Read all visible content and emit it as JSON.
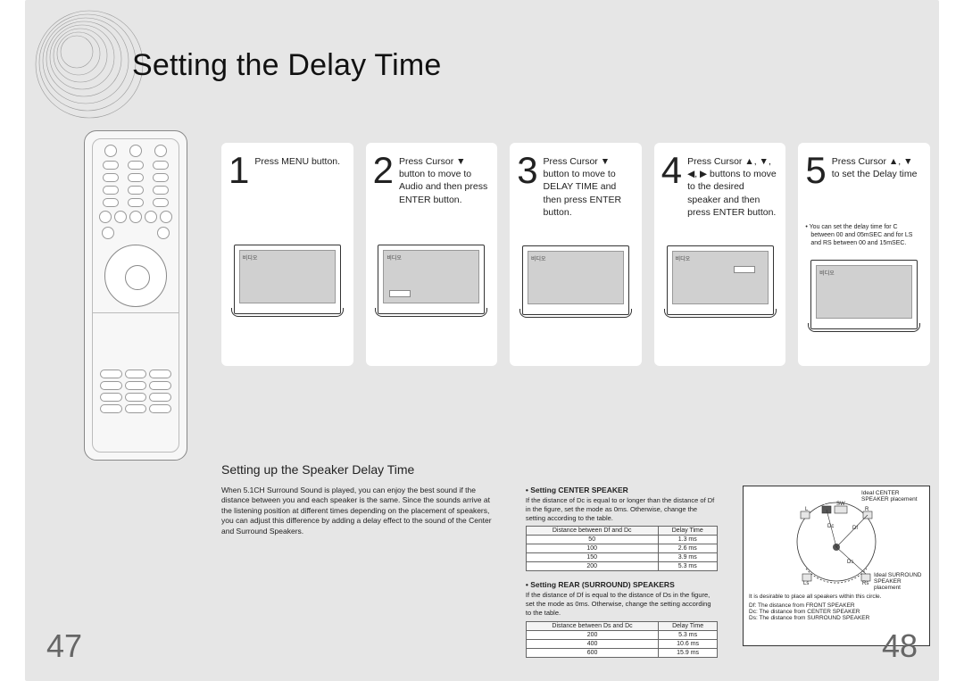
{
  "page": {
    "title": "Setting the Delay Time",
    "left_number": "47",
    "right_number": "48",
    "tv_label": "비디오"
  },
  "steps": [
    {
      "num": "1",
      "text": "Press MENU button."
    },
    {
      "num": "2",
      "text": "Press Cursor ▼ button to move to  Audio  and then press ENTER button."
    },
    {
      "num": "3",
      "text": "Press Cursor ▼ button to move to  DELAY TIME  and then press ENTER button."
    },
    {
      "num": "4",
      "text": "Press Cursor ▲, ▼, ◀, ▶ buttons to move to the desired speaker and then press ENTER button."
    },
    {
      "num": "5",
      "text": "Press Cursor ▲, ▼ to set the Delay time",
      "note": "• You can set the delay time for C between 00 and 05mSEC and for LS and RS between 00 and 15mSEC."
    }
  ],
  "setup": {
    "heading": "Setting up the Speaker Delay Time",
    "body": "When 5.1CH Surround Sound is played, you can enjoy the best sound if the distance between you and each speaker is the same. Since the sounds arrive at the listening position at different times depending on the placement of speakers, you can adjust this difference by adding a delay effect to the sound of the Center and Surround Speakers.",
    "center": {
      "heading": "• Setting CENTER SPEAKER",
      "text": "If the distance of Dc is equal to or longer than the distance of Df in the figure, set the mode as 0ms. Otherwise, change the setting according to the table.",
      "th1": "Distance between Df and Dc",
      "th2": "Delay Time",
      "rows": [
        {
          "d": "50",
          "t": "1.3 ms"
        },
        {
          "d": "100",
          "t": "2.6 ms"
        },
        {
          "d": "150",
          "t": "3.9 ms"
        },
        {
          "d": "200",
          "t": "5.3 ms"
        }
      ]
    },
    "rear": {
      "heading": "• Setting REAR (SURROUND) SPEAKERS",
      "text": "If the distance of Df is equal to the distance of Ds in the figure, set the mode as 0ms. Otherwise, change the setting according to the table.",
      "th1": "Distance between Ds and Dc",
      "th2": "Delay Time",
      "rows": [
        {
          "d": "200",
          "t": "5.3 ms"
        },
        {
          "d": "400",
          "t": "10.6 ms"
        },
        {
          "d": "600",
          "t": "15.9 ms"
        }
      ]
    },
    "diagram": {
      "ideal_center": "Ideal CENTER SPEAKER placement",
      "ideal_surround": "Ideal SURROUND SPEAKER placement",
      "caption": "It is desirable to place all speakers within this circle.",
      "legend": [
        "Df: The distance from FRONT SPEAKER",
        "Dc: The distance from CENTER SPEAKER",
        "Ds: The distance from SURROUND SPEAKER"
      ],
      "labels": {
        "L": "L",
        "C": "C",
        "SW": "SW",
        "R": "R",
        "Ls": "Ls",
        "Rs": "Rs",
        "Dc": "Dc",
        "Df": "Df",
        "Ds": "Ds"
      }
    }
  }
}
